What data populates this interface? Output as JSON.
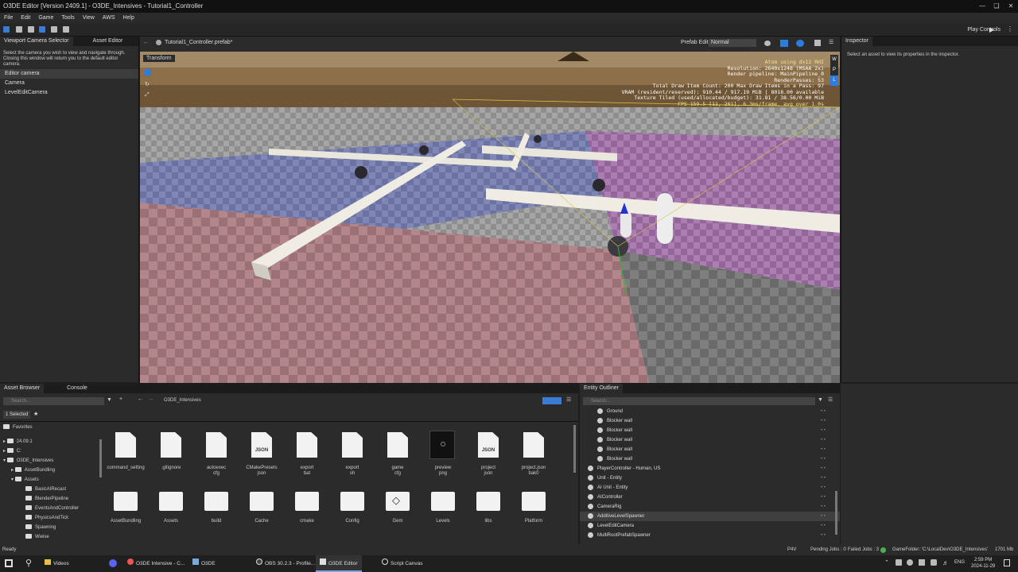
{
  "window": {
    "title": "O3DE Editor [Version 2409.1] - O3DE_Intensives - Tutorial1_Controller"
  },
  "menu": [
    "File",
    "Edit",
    "Game",
    "Tools",
    "View",
    "AWS",
    "Help"
  ],
  "toolbar": {
    "play_controls": "Play Controls"
  },
  "left_panel": {
    "tabs": [
      "Viewport Camera Selector",
      "Asset Editor"
    ],
    "description": "Select the camera you wish to view and navigate through. Closing this window will return you to the default editor camera.",
    "items": [
      "Editor camera",
      "Camera",
      "LevelEditCamera"
    ]
  },
  "viewport": {
    "prefab_path": "Tutorial1_Controller.prefab*",
    "prefab_edit_label": "Prefab Edit:",
    "prefab_edit_value": "Normal",
    "transform_label": "Transform",
    "stats": [
      "Atom using dx12 RHI",
      "Resolution: 2640x1248 (MSAA 2x)",
      "Render pipeline: MainPipeline_0",
      "RenderPasses: 53",
      "Total Draw Item Count: 200  Max Draw Items in a Pass: 97",
      "VRAM (resident/reserved): 910.44 / 917.19 MiB | 8018.00 available",
      "Texture Tiled (used/allocated/budget): 31.81 / 38.56/0.00 MiB",
      "FPS 159.5 [11, 261], 6.3ms/frame, avg over 1.0s"
    ],
    "side_buttons": [
      "W",
      "P",
      "L"
    ]
  },
  "inspector": {
    "tab": "Inspector",
    "message": "Select an asset to view its properties in the inspector."
  },
  "asset_browser": {
    "tabs": [
      "Asset Browser",
      "Console"
    ],
    "search_placeholder": "Search...",
    "breadcrumb": "O3DE_Intensives",
    "selected_badge": "1 Selected",
    "favorites": "Favorites",
    "tree": [
      "24.09.1",
      "C:",
      "O3DE_Intensives",
      "AssetBundling",
      "Assets",
      "BasicAIRecast",
      "BlenderPipeline",
      "EventsAndController",
      "PhysicsAndTick",
      "Spawning",
      "Wwise"
    ],
    "files": [
      {
        "name": "command_setting",
        "type": "file"
      },
      {
        "name": ".gitignore",
        "type": "file"
      },
      {
        "name": "autoexec\ncfg",
        "type": "file"
      },
      {
        "name": "CMakePresets\njson",
        "type": "json"
      },
      {
        "name": "export\nbat",
        "type": "file"
      },
      {
        "name": "export\nsh",
        "type": "file"
      },
      {
        "name": "game\ncfg",
        "type": "file"
      },
      {
        "name": "preview\npng",
        "type": "image"
      },
      {
        "name": "project\njson",
        "type": "json"
      },
      {
        "name": "project.json\nbak0",
        "type": "file"
      }
    ],
    "folders": [
      "AssetBundling",
      "Assets",
      "build",
      "Cache",
      "cmake",
      "Config",
      "Gem",
      "Levels",
      "libs",
      "Platform"
    ]
  },
  "entity_outliner": {
    "tab": "Entity Outliner",
    "search_placeholder": "Search...",
    "entities": [
      {
        "name": "Ground",
        "indent": 2,
        "selected": false
      },
      {
        "name": "Blocker wall",
        "indent": 2,
        "selected": false
      },
      {
        "name": "Blocker wall",
        "indent": 2,
        "selected": false
      },
      {
        "name": "Blocker wall",
        "indent": 2,
        "selected": false
      },
      {
        "name": "Blocker wall",
        "indent": 2,
        "selected": false
      },
      {
        "name": "Blocker wall",
        "indent": 2,
        "selected": false
      },
      {
        "name": "PlayerController - Human, US",
        "indent": 1,
        "selected": false
      },
      {
        "name": "Unit - Entity",
        "indent": 1,
        "selected": false
      },
      {
        "name": "AI Unit - Entity",
        "indent": 1,
        "selected": false
      },
      {
        "name": "AIController",
        "indent": 1,
        "selected": false
      },
      {
        "name": "CameraRig",
        "indent": 1,
        "selected": false
      },
      {
        "name": "AdditiveLevelSpawner",
        "indent": 1,
        "selected": true
      },
      {
        "name": "LevelEditCamera",
        "indent": 1,
        "selected": false
      },
      {
        "name": "MultiRootPrefabSpawner",
        "indent": 1,
        "selected": false
      }
    ]
  },
  "status": {
    "left": "Ready",
    "p4v": "P4V",
    "pending": "Pending Jobs : 0",
    "failed": "Failed Jobs : 3",
    "gamefolder": "GameFolder: 'C:\\LocalDev\\O3DE_Intensives'",
    "memory": "1701 Mb"
  },
  "taskbar": {
    "apps": [
      "Videos",
      "O3DE Intensive - C...",
      "O3DE",
      "OBS 30.2.3 - Profile...",
      "O3DE Editor",
      "Script Canvas"
    ],
    "lang": "ENG",
    "time": "2:59 PM",
    "date": "2024-11-29"
  }
}
